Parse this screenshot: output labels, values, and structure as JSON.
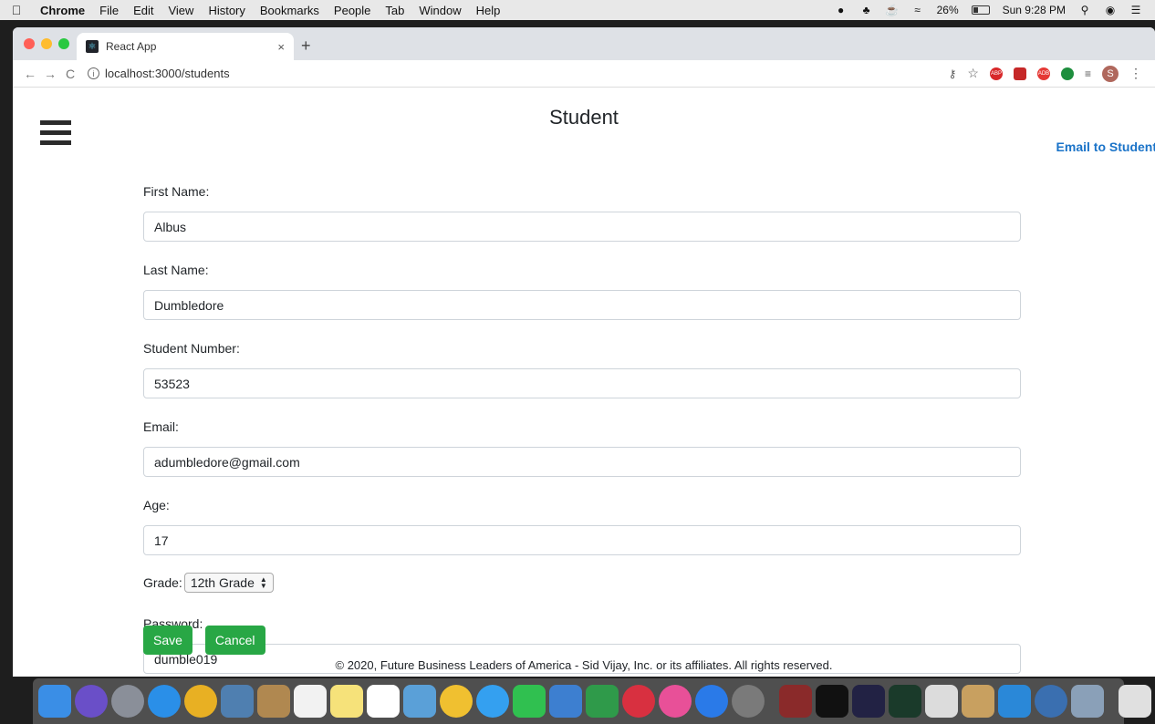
{
  "menubar": {
    "apple_icon": "apple-icon",
    "app_name": "Chrome",
    "items": [
      "File",
      "Edit",
      "View",
      "History",
      "Bookmarks",
      "People",
      "Tab",
      "Window",
      "Help"
    ],
    "battery_percent": "26%",
    "clock": "Sun 9:28 PM"
  },
  "browser": {
    "tab_title": "React App",
    "tab_close": "×",
    "new_tab": "+",
    "url": "localhost:3000/students",
    "back": "←",
    "forward": "→",
    "reload": "C",
    "avatar_initial": "S"
  },
  "page": {
    "title": "Student",
    "email_link": "Email to Student",
    "fields": {
      "first_name": {
        "label": "First Name:",
        "value": "Albus"
      },
      "last_name": {
        "label": "Last Name:",
        "value": "Dumbledore"
      },
      "student_number": {
        "label": "Student Number:",
        "value": "53523"
      },
      "email": {
        "label": "Email:",
        "value": "adumbledore@gmail.com"
      },
      "age": {
        "label": "Age:",
        "value": "17"
      },
      "grade": {
        "label": "Grade:",
        "selected": "12th Grade"
      },
      "password": {
        "label": "Password:",
        "value": "dumble019"
      }
    },
    "buttons": {
      "save": "Save",
      "cancel": "Cancel"
    },
    "footer": "© 2020, Future Business Leaders of America - Sid Vijay, Inc. or its affiliates. All rights reserved."
  },
  "colors": {
    "accent_green": "#28a745",
    "link_blue": "#1a73c8"
  }
}
